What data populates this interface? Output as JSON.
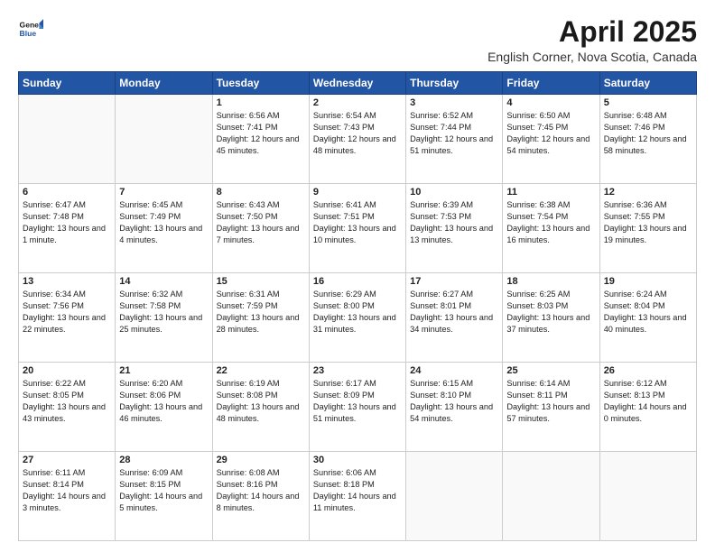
{
  "logo": {
    "line1": "General",
    "line2": "Blue"
  },
  "title": "April 2025",
  "subtitle": "English Corner, Nova Scotia, Canada",
  "headers": [
    "Sunday",
    "Monday",
    "Tuesday",
    "Wednesday",
    "Thursday",
    "Friday",
    "Saturday"
  ],
  "weeks": [
    [
      {
        "day": "",
        "info": ""
      },
      {
        "day": "",
        "info": ""
      },
      {
        "day": "1",
        "info": "Sunrise: 6:56 AM\nSunset: 7:41 PM\nDaylight: 12 hours and 45 minutes."
      },
      {
        "day": "2",
        "info": "Sunrise: 6:54 AM\nSunset: 7:43 PM\nDaylight: 12 hours and 48 minutes."
      },
      {
        "day": "3",
        "info": "Sunrise: 6:52 AM\nSunset: 7:44 PM\nDaylight: 12 hours and 51 minutes."
      },
      {
        "day": "4",
        "info": "Sunrise: 6:50 AM\nSunset: 7:45 PM\nDaylight: 12 hours and 54 minutes."
      },
      {
        "day": "5",
        "info": "Sunrise: 6:48 AM\nSunset: 7:46 PM\nDaylight: 12 hours and 58 minutes."
      }
    ],
    [
      {
        "day": "6",
        "info": "Sunrise: 6:47 AM\nSunset: 7:48 PM\nDaylight: 13 hours and 1 minute."
      },
      {
        "day": "7",
        "info": "Sunrise: 6:45 AM\nSunset: 7:49 PM\nDaylight: 13 hours and 4 minutes."
      },
      {
        "day": "8",
        "info": "Sunrise: 6:43 AM\nSunset: 7:50 PM\nDaylight: 13 hours and 7 minutes."
      },
      {
        "day": "9",
        "info": "Sunrise: 6:41 AM\nSunset: 7:51 PM\nDaylight: 13 hours and 10 minutes."
      },
      {
        "day": "10",
        "info": "Sunrise: 6:39 AM\nSunset: 7:53 PM\nDaylight: 13 hours and 13 minutes."
      },
      {
        "day": "11",
        "info": "Sunrise: 6:38 AM\nSunset: 7:54 PM\nDaylight: 13 hours and 16 minutes."
      },
      {
        "day": "12",
        "info": "Sunrise: 6:36 AM\nSunset: 7:55 PM\nDaylight: 13 hours and 19 minutes."
      }
    ],
    [
      {
        "day": "13",
        "info": "Sunrise: 6:34 AM\nSunset: 7:56 PM\nDaylight: 13 hours and 22 minutes."
      },
      {
        "day": "14",
        "info": "Sunrise: 6:32 AM\nSunset: 7:58 PM\nDaylight: 13 hours and 25 minutes."
      },
      {
        "day": "15",
        "info": "Sunrise: 6:31 AM\nSunset: 7:59 PM\nDaylight: 13 hours and 28 minutes."
      },
      {
        "day": "16",
        "info": "Sunrise: 6:29 AM\nSunset: 8:00 PM\nDaylight: 13 hours and 31 minutes."
      },
      {
        "day": "17",
        "info": "Sunrise: 6:27 AM\nSunset: 8:01 PM\nDaylight: 13 hours and 34 minutes."
      },
      {
        "day": "18",
        "info": "Sunrise: 6:25 AM\nSunset: 8:03 PM\nDaylight: 13 hours and 37 minutes."
      },
      {
        "day": "19",
        "info": "Sunrise: 6:24 AM\nSunset: 8:04 PM\nDaylight: 13 hours and 40 minutes."
      }
    ],
    [
      {
        "day": "20",
        "info": "Sunrise: 6:22 AM\nSunset: 8:05 PM\nDaylight: 13 hours and 43 minutes."
      },
      {
        "day": "21",
        "info": "Sunrise: 6:20 AM\nSunset: 8:06 PM\nDaylight: 13 hours and 46 minutes."
      },
      {
        "day": "22",
        "info": "Sunrise: 6:19 AM\nSunset: 8:08 PM\nDaylight: 13 hours and 48 minutes."
      },
      {
        "day": "23",
        "info": "Sunrise: 6:17 AM\nSunset: 8:09 PM\nDaylight: 13 hours and 51 minutes."
      },
      {
        "day": "24",
        "info": "Sunrise: 6:15 AM\nSunset: 8:10 PM\nDaylight: 13 hours and 54 minutes."
      },
      {
        "day": "25",
        "info": "Sunrise: 6:14 AM\nSunset: 8:11 PM\nDaylight: 13 hours and 57 minutes."
      },
      {
        "day": "26",
        "info": "Sunrise: 6:12 AM\nSunset: 8:13 PM\nDaylight: 14 hours and 0 minutes."
      }
    ],
    [
      {
        "day": "27",
        "info": "Sunrise: 6:11 AM\nSunset: 8:14 PM\nDaylight: 14 hours and 3 minutes."
      },
      {
        "day": "28",
        "info": "Sunrise: 6:09 AM\nSunset: 8:15 PM\nDaylight: 14 hours and 5 minutes."
      },
      {
        "day": "29",
        "info": "Sunrise: 6:08 AM\nSunset: 8:16 PM\nDaylight: 14 hours and 8 minutes."
      },
      {
        "day": "30",
        "info": "Sunrise: 6:06 AM\nSunset: 8:18 PM\nDaylight: 14 hours and 11 minutes."
      },
      {
        "day": "",
        "info": ""
      },
      {
        "day": "",
        "info": ""
      },
      {
        "day": "",
        "info": ""
      }
    ]
  ]
}
